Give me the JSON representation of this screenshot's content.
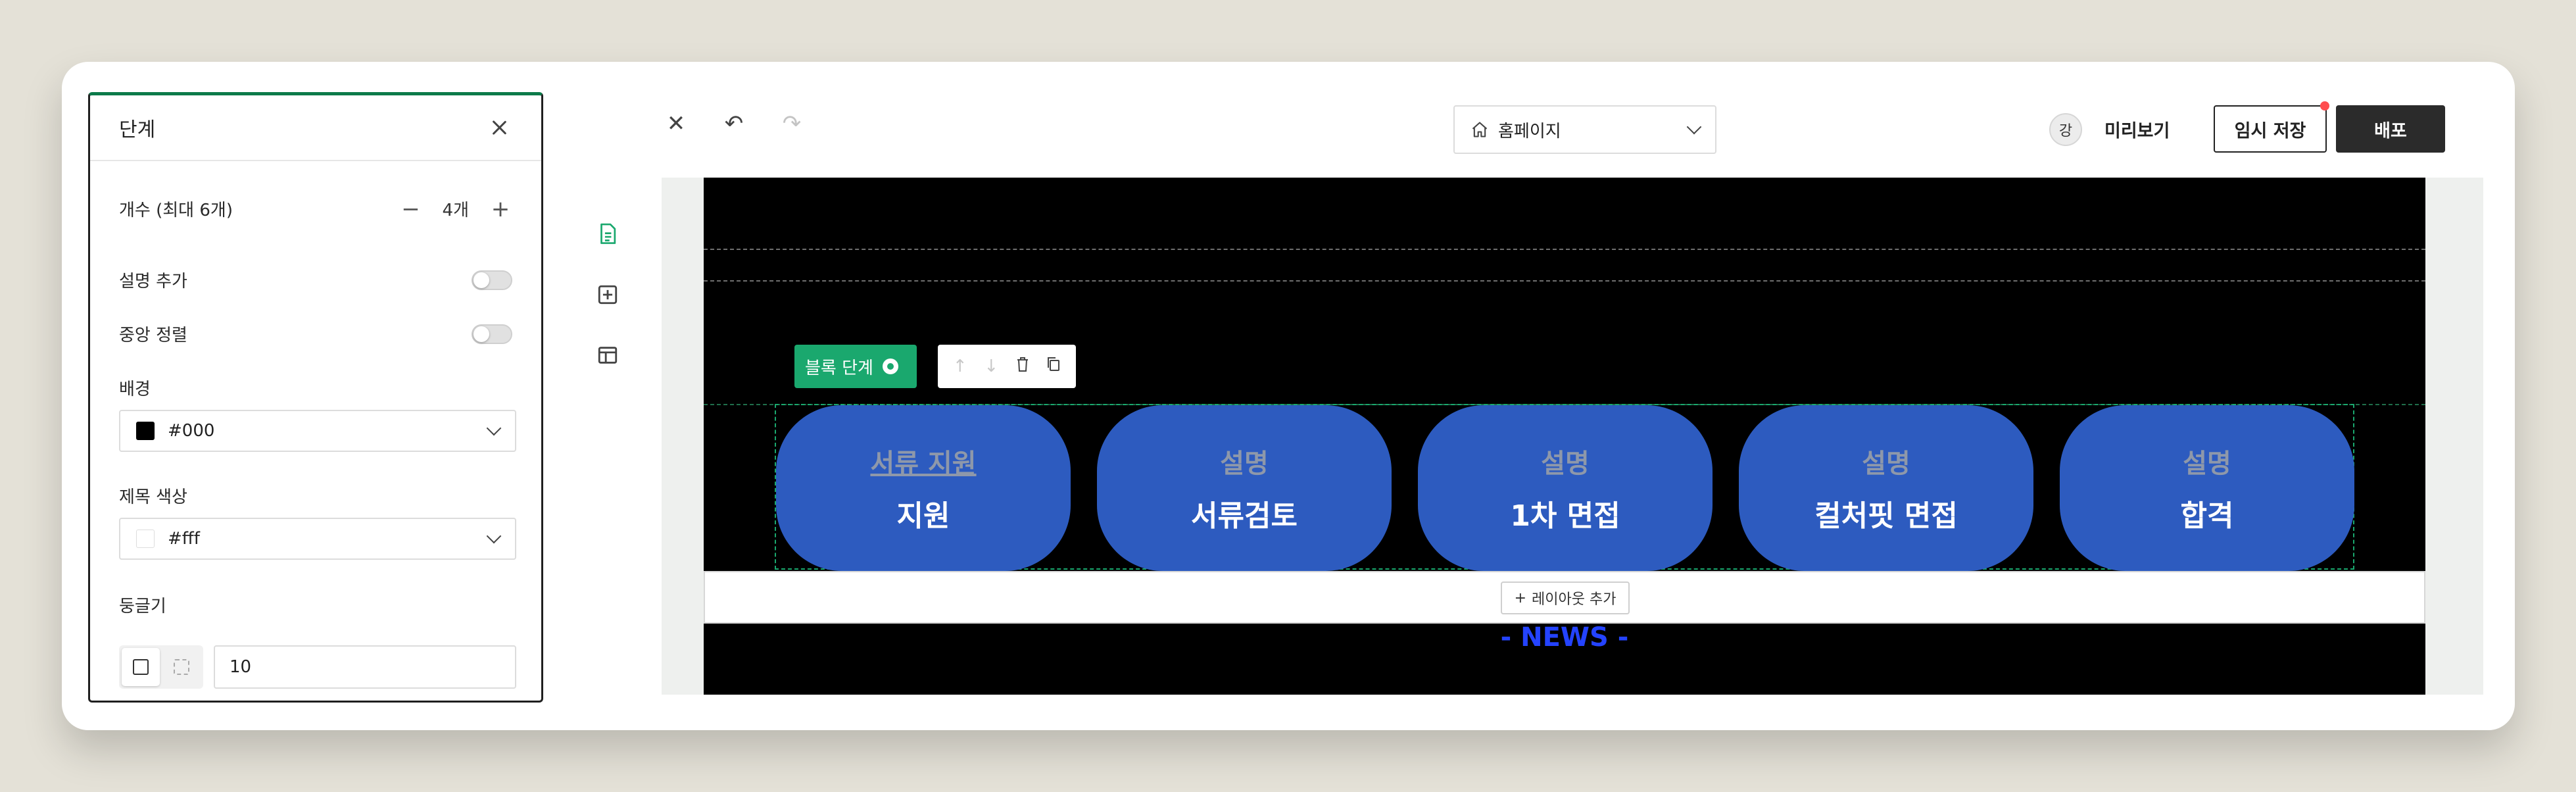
{
  "panel": {
    "title": "단계",
    "count_label": "개수 (최대 6개)",
    "count_value": "4개",
    "add_description_label": "설명 추가",
    "add_description_on": false,
    "center_align_label": "중앙 정렬",
    "center_align_on": false,
    "background_label": "배경",
    "background_value": "#000",
    "background_color": "#000000",
    "title_color_label": "제목 색상",
    "title_color_value": "#fff",
    "title_color": "#ffffff",
    "radius_label": "둥글기",
    "radius_value": "10"
  },
  "topbar": {
    "page_select": "홈페이지",
    "avatar": "강",
    "preview_label": "미리보기",
    "save_label": "임시 저장",
    "deploy_label": "배포"
  },
  "canvas": {
    "block_tag_label": "블록 단계",
    "add_layout_label": "레이아웃 추가",
    "news_title": "- NEWS -",
    "steps": [
      {
        "desc": "서류 지원",
        "title": "지원"
      },
      {
        "desc": "설명",
        "title": "서류검토"
      },
      {
        "desc": "설명",
        "title": "1차 면접"
      },
      {
        "desc": "설명",
        "title": "컬처핏 면접"
      },
      {
        "desc": "설명",
        "title": "합격"
      }
    ]
  },
  "colors": {
    "accent_green": "#1aa86e",
    "step_blue": "#2d5bbf",
    "news_blue": "#2443ff"
  }
}
